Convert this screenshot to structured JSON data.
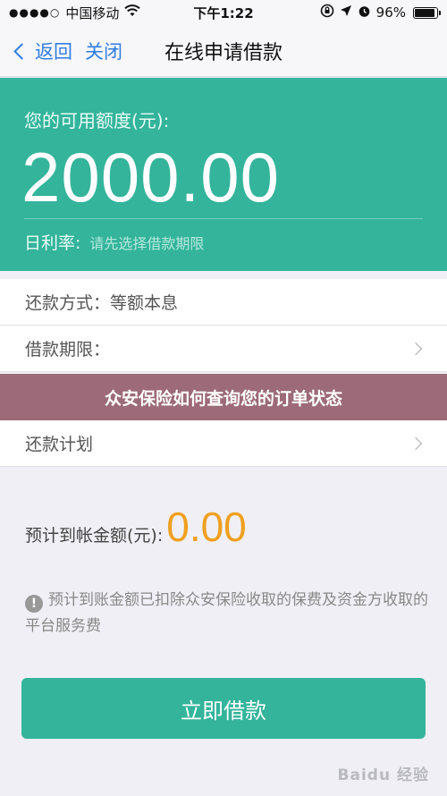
{
  "status_bar": {
    "signal": "●●●●○",
    "carrier": "中国移动",
    "time": "下午1:22",
    "battery_percent": "96%"
  },
  "nav": {
    "back_label": "返回",
    "close_label": "关闭",
    "title": "在线申请借款"
  },
  "credit": {
    "label": "您的可用额度(元):",
    "amount": "2000.00",
    "rate_label": "日利率:",
    "rate_hint": "请先选择借款期限"
  },
  "list": {
    "repay_method": "还款方式：等额本息",
    "loan_term": "借款期限：",
    "repay_plan": "还款计划"
  },
  "overlay": {
    "text": "众安保险如何查询您的订单状态"
  },
  "arrival": {
    "label": "预计到帐金额(元):",
    "amount": "0.00"
  },
  "notice": {
    "text": "预计到账金额已扣除众安保险收取的保费及资金方收取的平台服务费"
  },
  "button": {
    "label": "立即借款"
  },
  "watermark": {
    "text": "Baidu 经验"
  },
  "colors": {
    "accent": "#33b49b",
    "link": "#2f7de1",
    "amount_highlight": "#f0a020",
    "banner": "#9c6a78"
  }
}
